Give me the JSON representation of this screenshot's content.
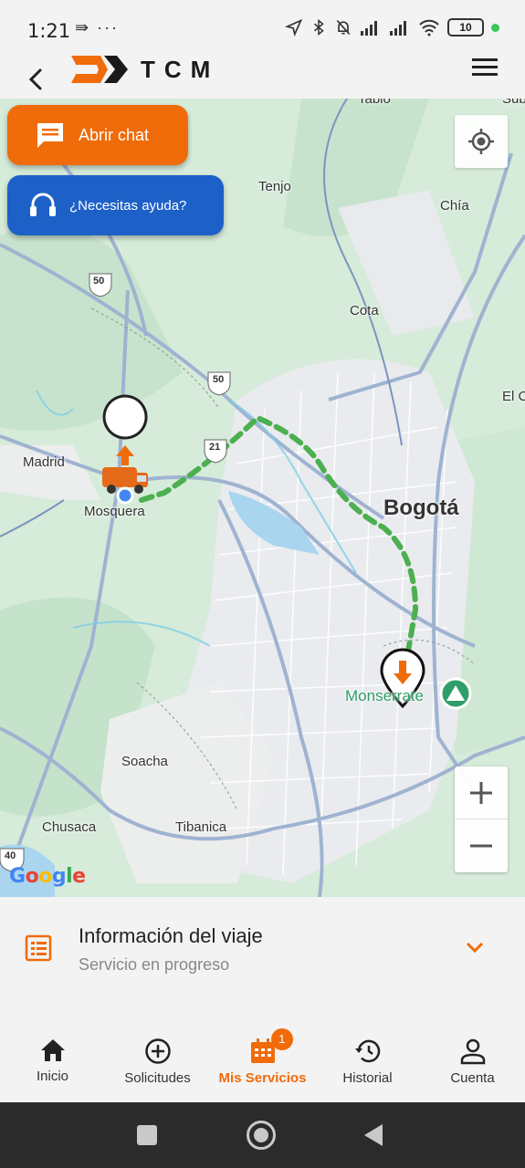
{
  "status": {
    "time": "1:21",
    "left_icons": "⇛ ···",
    "battery": "10"
  },
  "header": {
    "logo_text": "TCM",
    "back_icon": "back-arrow-icon",
    "menu_icon": "hamburger-menu-icon"
  },
  "map": {
    "chat_button_label": "Abrir chat",
    "help_button_label": "¿Necesitas ayuda?",
    "labels": {
      "tabio": "Tabio",
      "tenjo": "Tenjo",
      "chia": "Chía",
      "cota": "Cota",
      "madrid": "Madrid",
      "mosquera": "Mosquera",
      "bogota": "Bogotá",
      "monserrate": "Monserrate",
      "soacha": "Soacha",
      "chusaca": "Chusaca",
      "tibanica": "Tibanica",
      "el_c": "El C",
      "suba": "Suba"
    },
    "route_shields": [
      "50",
      "50",
      "21",
      "40"
    ],
    "google": "Google",
    "colors": {
      "route": "#4caf50",
      "accent": "#f06b0a",
      "help": "#1d61c8"
    }
  },
  "info": {
    "title": "Información del viaje",
    "subtitle": "Servicio en progreso"
  },
  "nav": {
    "items": [
      {
        "label": "Inicio",
        "icon": "home-icon"
      },
      {
        "label": "Solicitudes",
        "icon": "plus-circle-icon"
      },
      {
        "label": "Mis Servicios",
        "icon": "calendar-icon",
        "badge": "1"
      },
      {
        "label": "Historial",
        "icon": "history-icon"
      },
      {
        "label": "Cuenta",
        "icon": "person-icon"
      }
    ]
  }
}
